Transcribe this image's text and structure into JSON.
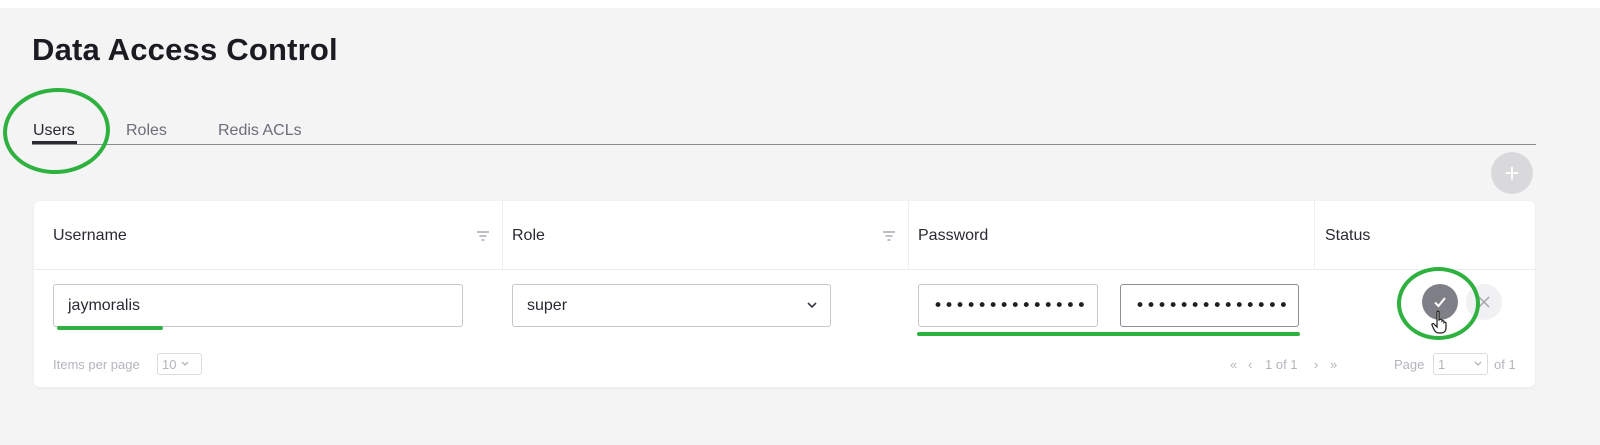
{
  "page": {
    "title": "Data Access Control"
  },
  "tabs": [
    {
      "label": "Users",
      "active": true
    },
    {
      "label": "Roles",
      "active": false
    },
    {
      "label": "Redis ACLs",
      "active": false
    }
  ],
  "add_button": {
    "icon": "plus-icon"
  },
  "table": {
    "columns": [
      {
        "label": "Username",
        "filter_icon": "filter-icon"
      },
      {
        "label": "Role",
        "filter_icon": "filter-icon"
      },
      {
        "label": "Password"
      },
      {
        "label": "Status"
      }
    ],
    "edit_row": {
      "username_value": "jaymoralis",
      "role_value": "super",
      "password_value": "••••••••••••••",
      "confirm_password_value": "••••••••••••••",
      "save_icon": "check-icon",
      "cancel_icon": "close-icon"
    },
    "footer": {
      "items_per_page_label": "Items per page",
      "items_per_page_value": "10",
      "pagination_text": "1 of 1",
      "page_label": "Page",
      "page_value": "1",
      "of_label": "of 1"
    }
  },
  "colors": {
    "annotation": "#2fb13f",
    "primary_text": "#1b1b22",
    "save_button": "#7f7f88"
  }
}
